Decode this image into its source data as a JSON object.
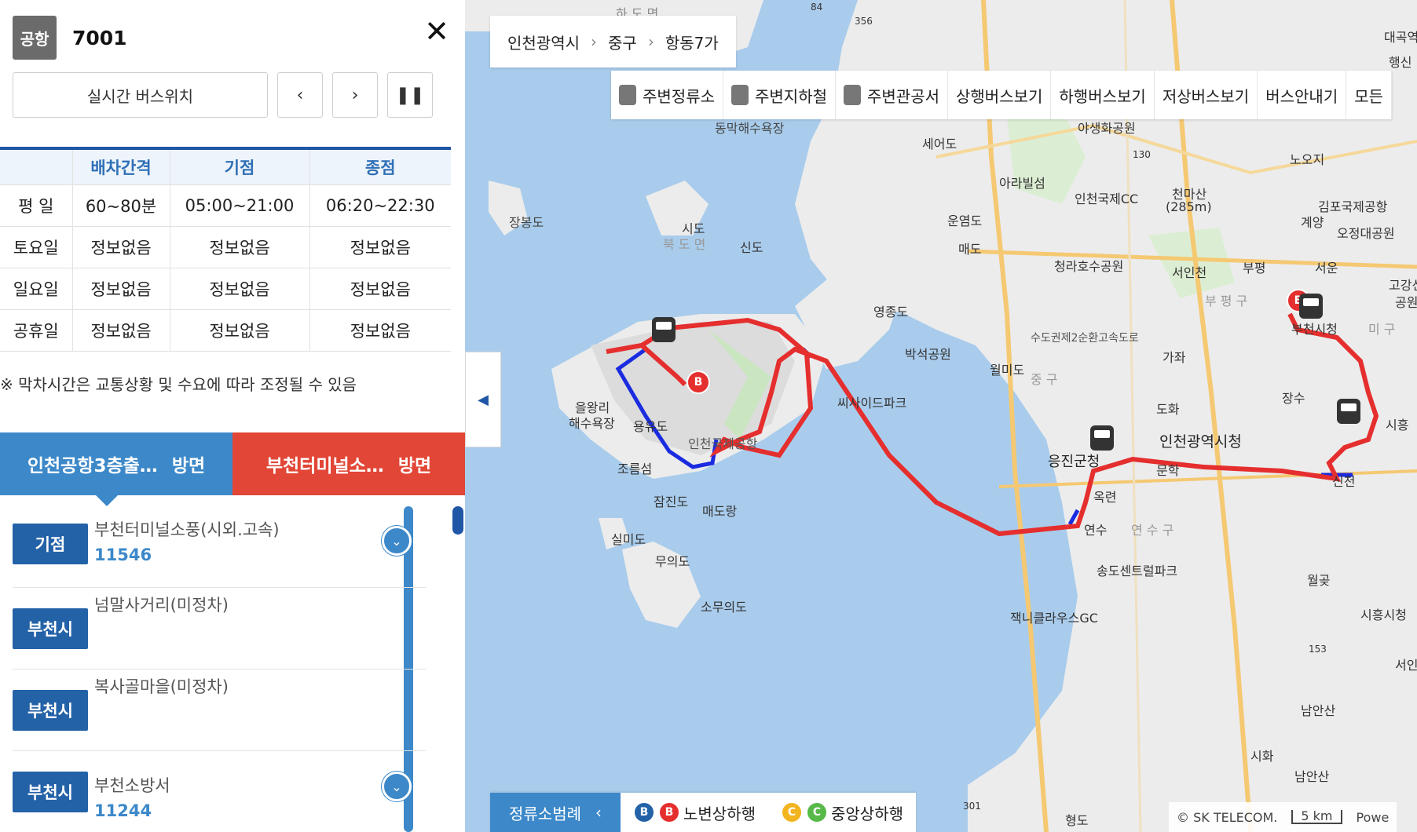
{
  "header": {
    "type_badge": "공항",
    "route_number": "7001",
    "close_icon": "close-icon"
  },
  "controls": {
    "realtime_label": "실시간 버스위치",
    "prev": "‹",
    "next": "›",
    "pause": "❚❚"
  },
  "schedule": {
    "headers": [
      "",
      "배차간격",
      "기점",
      "종점"
    ],
    "rows": [
      [
        "평 일",
        "60~80분",
        "05:00~21:00",
        "06:20~22:30"
      ],
      [
        "토요일",
        "정보없음",
        "정보없음",
        "정보없음"
      ],
      [
        "일요일",
        "정보없음",
        "정보없음",
        "정보없음"
      ],
      [
        "공휴일",
        "정보없음",
        "정보없음",
        "정보없음"
      ]
    ],
    "note": "※ 막차시간은 교통상황 및 수요에 따라 조정될 수 있음"
  },
  "direction_tabs": [
    {
      "name": "인천공항3층출…",
      "suffix": "방면",
      "color": "#3c88c9"
    },
    {
      "name": "부천터미널소…",
      "suffix": "방면",
      "color": "#e24636"
    }
  ],
  "stops": [
    {
      "tag": "기점",
      "name": "부천터미널소풍(시외.고속)",
      "id": "11546"
    },
    {
      "tag": "부천시",
      "name": "넘말사거리(미정차)",
      "id": ""
    },
    {
      "tag": "부천시",
      "name": "복사골마을(미정차)",
      "id": ""
    },
    {
      "tag": "부천시",
      "name": "부천소방서",
      "id": "11244"
    }
  ],
  "map": {
    "breadcrumb": [
      "인천광역시",
      "중구",
      "항동7가"
    ],
    "toolbar": [
      "주변정류소",
      "주변지하철",
      "주변관공서",
      "상행버스보기",
      "하행버스보기",
      "저상버스보기",
      "버스안내기",
      "모든"
    ],
    "legend": {
      "button": "정류소범례",
      "items": [
        "노변상하행",
        "중앙상하행"
      ],
      "marker_letters": [
        "B",
        "B",
        "C",
        "C"
      ]
    },
    "scale": {
      "copyright": "© SK TELECOM.",
      "distance": "5 km",
      "powered": "Powe"
    },
    "colors": {
      "route_red": "#e52e2e",
      "route_blue": "#1a2be0",
      "sea": "#a9ccec",
      "land": "#ececec"
    },
    "labels": [
      "하 도 면",
      "84",
      "356",
      "대곡역",
      "행신",
      "동막해수욕장",
      "야생화공원",
      "세어도",
      "노오지",
      "김포국제공항",
      "아라빌섬",
      "인천국제CC",
      "천마산",
      "(285m)",
      "계양",
      "오정대공원",
      "장봉도",
      "시도",
      "북 도 면",
      "신도",
      "운염도",
      "매도",
      "청라호수공원",
      "서인천",
      "부평",
      "서운",
      "고강선사",
      "공원",
      "영종도",
      "박석공원",
      "부 평 구",
      "부천시청",
      "월미도",
      "가좌",
      "장수",
      "을왕리",
      "해수욕장",
      "용유도",
      "인천국제공항",
      "씨사이드파크",
      "도화",
      "인천광역시청",
      "시흥",
      "조름섬",
      "응진군청",
      "문학",
      "신천",
      "잠진도",
      "매도랑",
      "옥련",
      "실미도",
      "연수",
      "연 수 구",
      "무의도",
      "송도센트럴파크",
      "월곶",
      "소무의도",
      "잭니클라우스GC",
      "시흥시청",
      "서인",
      "남안산",
      "시화",
      "남안산",
      "형도",
      "130",
      "153",
      "301",
      "미 구",
      "중 구",
      "수도권제2순환고속도로"
    ]
  }
}
